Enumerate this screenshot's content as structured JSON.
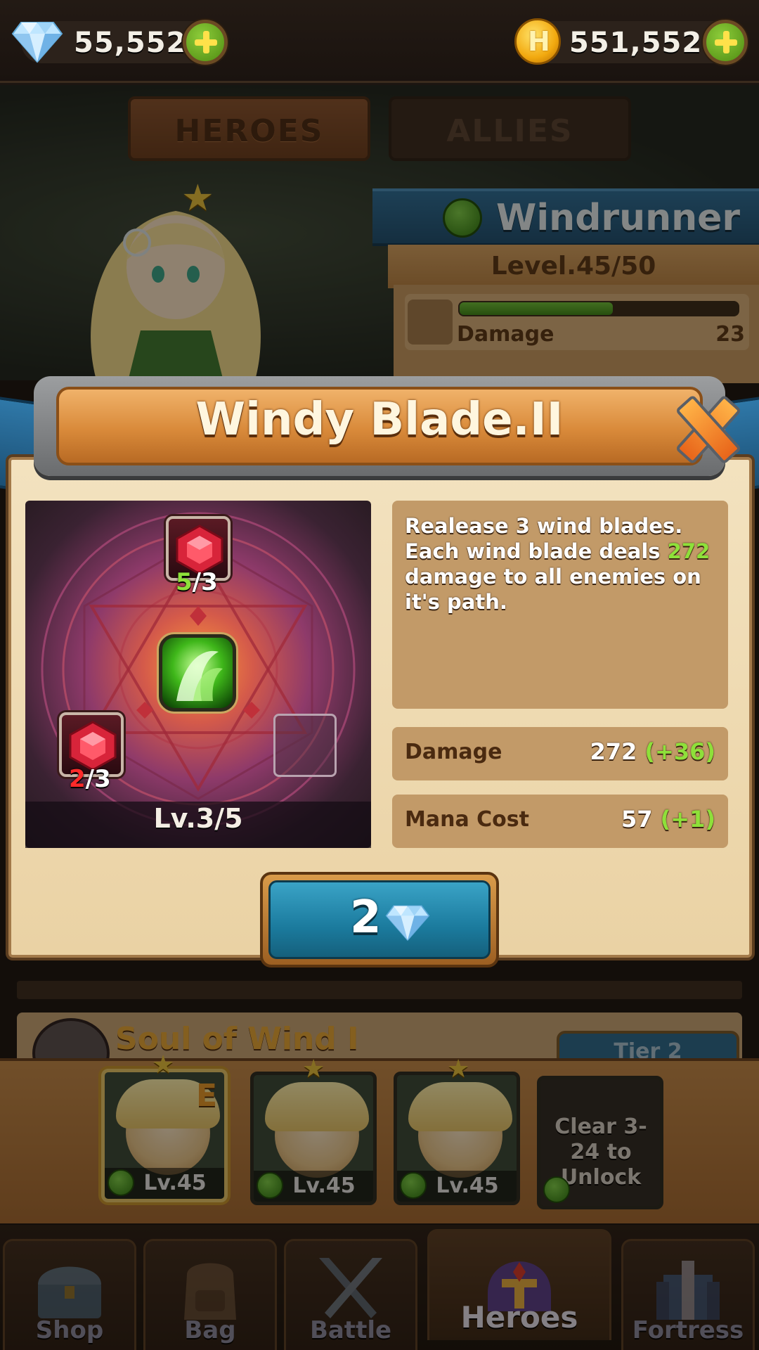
{
  "currency": {
    "gems": "55,552",
    "gold": "551,552",
    "gold_icon_letter": "H"
  },
  "tabs": [
    {
      "label": "HEROES",
      "active": true
    },
    {
      "label": "ALLIES",
      "active": false
    }
  ],
  "hero": {
    "name": "Windrunner",
    "level": "Level.45/50",
    "element_icon": "wind-element-icon",
    "stats": [
      {
        "label": "Damage",
        "value": "23",
        "fill": 0.55
      }
    ]
  },
  "skill_popup": {
    "title": "Windy Blade.II",
    "description_parts": [
      "Realease 3 wind blades. Each wind blade deals ",
      "272",
      " damage to all enemies on it's path."
    ],
    "gem_slots": [
      {
        "current": "5",
        "required": "/3",
        "state": "complete"
      },
      {
        "current": "2",
        "required": "/3",
        "state": "incomplete"
      }
    ],
    "skill_level": "Lv.3/5",
    "stats": [
      {
        "label": "Damage",
        "value": "272",
        "bonus": "(+36)"
      },
      {
        "label": "Mana Cost",
        "value": "57",
        "bonus": "(+1)"
      }
    ],
    "upgrade_cost": "2",
    "upgrade_currency_icon": "diamond-icon"
  },
  "skill_list": {
    "item_name": "Soul of Wind I",
    "tier_label": "Tier 2"
  },
  "roster": [
    {
      "level": "Lv.45",
      "grade": "E",
      "selected": true,
      "locked": false
    },
    {
      "level": "Lv.45",
      "grade": "",
      "selected": false,
      "locked": false
    },
    {
      "level": "Lv.45",
      "grade": "",
      "selected": false,
      "locked": false
    },
    {
      "level": "",
      "grade": "",
      "selected": false,
      "locked": true,
      "unlock_text": "Clear 3-24 to Unlock"
    }
  ],
  "nav": [
    {
      "label": "Shop",
      "icon": "treasure-chest-icon"
    },
    {
      "label": "Bag",
      "icon": "backpack-icon"
    },
    {
      "label": "Battle",
      "icon": "crossed-swords-icon"
    },
    {
      "label": "Heroes",
      "icon": "helmet-icon",
      "active": true
    },
    {
      "label": "Fortress",
      "icon": "castle-icon"
    }
  ],
  "colors": {
    "highlight_green": "#8ee03a",
    "warning_red": "#ff2a2a",
    "button_blue": "#1b7b9e",
    "ribbon_blue": "#2c6f9a",
    "wood_orange": "#d98a3a"
  }
}
